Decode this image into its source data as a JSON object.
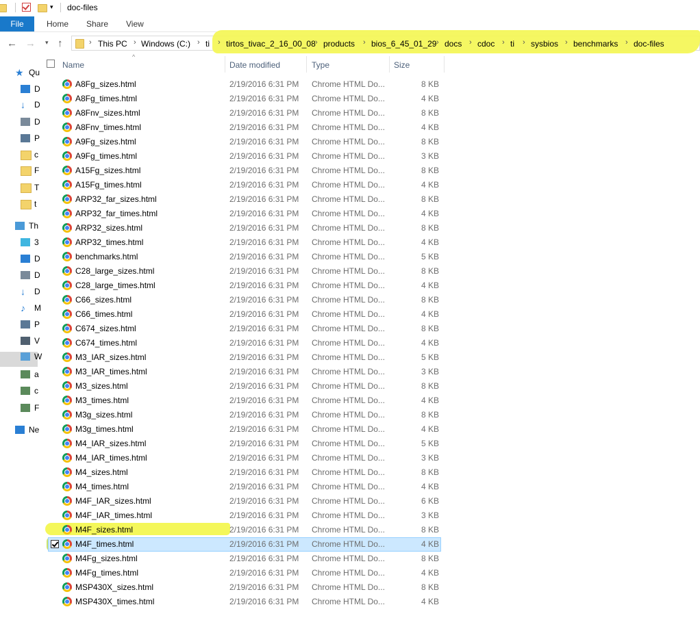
{
  "window": {
    "title": "doc-files"
  },
  "ribbon": {
    "file": "File",
    "tabs": [
      "Home",
      "Share",
      "View"
    ]
  },
  "address": {
    "crumbs": [
      "This PC",
      "Windows (C:)",
      "ti",
      "tirtos_tivac_2_16_00_08",
      "products",
      "bios_6_45_01_29",
      "docs",
      "cdoc",
      "ti",
      "sysbios",
      "benchmarks",
      "doc-files"
    ]
  },
  "columns": {
    "name": "Name",
    "date": "Date modified",
    "type": "Type",
    "size": "Size"
  },
  "sidebar": {
    "items": [
      {
        "label": "Qu",
        "icon": "star-icon"
      },
      {
        "label": "D",
        "icon": "desktop-icon"
      },
      {
        "label": "D",
        "icon": "download-icon"
      },
      {
        "label": "D",
        "icon": "document-icon"
      },
      {
        "label": "P",
        "icon": "picture-icon"
      },
      {
        "label": "c",
        "icon": "folder-icon"
      },
      {
        "label": "F",
        "icon": "folder-icon"
      },
      {
        "label": "T",
        "icon": "folder-icon"
      },
      {
        "label": "t",
        "icon": "folder-icon"
      },
      {
        "label": "Th",
        "icon": "computer-icon"
      },
      {
        "label": "3",
        "icon": "cube-icon"
      },
      {
        "label": "D",
        "icon": "desktop-icon"
      },
      {
        "label": "D",
        "icon": "document-icon"
      },
      {
        "label": "D",
        "icon": "download-icon"
      },
      {
        "label": "M",
        "icon": "music-icon"
      },
      {
        "label": "P",
        "icon": "picture-icon"
      },
      {
        "label": "V",
        "icon": "video-icon"
      },
      {
        "label": "W",
        "icon": "drive-icon"
      },
      {
        "label": "a",
        "icon": "network-drive-icon"
      },
      {
        "label": "c",
        "icon": "network-drive-icon"
      },
      {
        "label": "F",
        "icon": "network-drive-icon"
      },
      {
        "label": "Ne",
        "icon": "network-icon"
      }
    ]
  },
  "files": [
    {
      "name": "A8Fg_sizes.html",
      "date": "2/19/2016 6:31 PM",
      "type": "Chrome HTML Do...",
      "size": "8 KB"
    },
    {
      "name": "A8Fg_times.html",
      "date": "2/19/2016 6:31 PM",
      "type": "Chrome HTML Do...",
      "size": "4 KB"
    },
    {
      "name": "A8Fnv_sizes.html",
      "date": "2/19/2016 6:31 PM",
      "type": "Chrome HTML Do...",
      "size": "8 KB"
    },
    {
      "name": "A8Fnv_times.html",
      "date": "2/19/2016 6:31 PM",
      "type": "Chrome HTML Do...",
      "size": "4 KB"
    },
    {
      "name": "A9Fg_sizes.html",
      "date": "2/19/2016 6:31 PM",
      "type": "Chrome HTML Do...",
      "size": "8 KB"
    },
    {
      "name": "A9Fg_times.html",
      "date": "2/19/2016 6:31 PM",
      "type": "Chrome HTML Do...",
      "size": "3 KB"
    },
    {
      "name": "A15Fg_sizes.html",
      "date": "2/19/2016 6:31 PM",
      "type": "Chrome HTML Do...",
      "size": "8 KB"
    },
    {
      "name": "A15Fg_times.html",
      "date": "2/19/2016 6:31 PM",
      "type": "Chrome HTML Do...",
      "size": "4 KB"
    },
    {
      "name": "ARP32_far_sizes.html",
      "date": "2/19/2016 6:31 PM",
      "type": "Chrome HTML Do...",
      "size": "8 KB"
    },
    {
      "name": "ARP32_far_times.html",
      "date": "2/19/2016 6:31 PM",
      "type": "Chrome HTML Do...",
      "size": "4 KB"
    },
    {
      "name": "ARP32_sizes.html",
      "date": "2/19/2016 6:31 PM",
      "type": "Chrome HTML Do...",
      "size": "8 KB"
    },
    {
      "name": "ARP32_times.html",
      "date": "2/19/2016 6:31 PM",
      "type": "Chrome HTML Do...",
      "size": "4 KB"
    },
    {
      "name": "benchmarks.html",
      "date": "2/19/2016 6:31 PM",
      "type": "Chrome HTML Do...",
      "size": "5 KB"
    },
    {
      "name": "C28_large_sizes.html",
      "date": "2/19/2016 6:31 PM",
      "type": "Chrome HTML Do...",
      "size": "8 KB"
    },
    {
      "name": "C28_large_times.html",
      "date": "2/19/2016 6:31 PM",
      "type": "Chrome HTML Do...",
      "size": "4 KB"
    },
    {
      "name": "C66_sizes.html",
      "date": "2/19/2016 6:31 PM",
      "type": "Chrome HTML Do...",
      "size": "8 KB"
    },
    {
      "name": "C66_times.html",
      "date": "2/19/2016 6:31 PM",
      "type": "Chrome HTML Do...",
      "size": "4 KB"
    },
    {
      "name": "C674_sizes.html",
      "date": "2/19/2016 6:31 PM",
      "type": "Chrome HTML Do...",
      "size": "8 KB"
    },
    {
      "name": "C674_times.html",
      "date": "2/19/2016 6:31 PM",
      "type": "Chrome HTML Do...",
      "size": "4 KB"
    },
    {
      "name": "M3_IAR_sizes.html",
      "date": "2/19/2016 6:31 PM",
      "type": "Chrome HTML Do...",
      "size": "5 KB"
    },
    {
      "name": "M3_IAR_times.html",
      "date": "2/19/2016 6:31 PM",
      "type": "Chrome HTML Do...",
      "size": "3 KB"
    },
    {
      "name": "M3_sizes.html",
      "date": "2/19/2016 6:31 PM",
      "type": "Chrome HTML Do...",
      "size": "8 KB"
    },
    {
      "name": "M3_times.html",
      "date": "2/19/2016 6:31 PM",
      "type": "Chrome HTML Do...",
      "size": "4 KB"
    },
    {
      "name": "M3g_sizes.html",
      "date": "2/19/2016 6:31 PM",
      "type": "Chrome HTML Do...",
      "size": "8 KB"
    },
    {
      "name": "M3g_times.html",
      "date": "2/19/2016 6:31 PM",
      "type": "Chrome HTML Do...",
      "size": "4 KB"
    },
    {
      "name": "M4_IAR_sizes.html",
      "date": "2/19/2016 6:31 PM",
      "type": "Chrome HTML Do...",
      "size": "5 KB"
    },
    {
      "name": "M4_IAR_times.html",
      "date": "2/19/2016 6:31 PM",
      "type": "Chrome HTML Do...",
      "size": "3 KB"
    },
    {
      "name": "M4_sizes.html",
      "date": "2/19/2016 6:31 PM",
      "type": "Chrome HTML Do...",
      "size": "8 KB"
    },
    {
      "name": "M4_times.html",
      "date": "2/19/2016 6:31 PM",
      "type": "Chrome HTML Do...",
      "size": "4 KB"
    },
    {
      "name": "M4F_IAR_sizes.html",
      "date": "2/19/2016 6:31 PM",
      "type": "Chrome HTML Do...",
      "size": "6 KB"
    },
    {
      "name": "M4F_IAR_times.html",
      "date": "2/19/2016 6:31 PM",
      "type": "Chrome HTML Do...",
      "size": "3 KB"
    },
    {
      "name": "M4F_sizes.html",
      "date": "2/19/2016 6:31 PM",
      "type": "Chrome HTML Do...",
      "size": "8 KB"
    },
    {
      "name": "M4F_times.html",
      "date": "2/19/2016 6:31 PM",
      "type": "Chrome HTML Do...",
      "size": "4 KB",
      "selected": true
    },
    {
      "name": "M4Fg_sizes.html",
      "date": "2/19/2016 6:31 PM",
      "type": "Chrome HTML Do...",
      "size": "8 KB"
    },
    {
      "name": "M4Fg_times.html",
      "date": "2/19/2016 6:31 PM",
      "type": "Chrome HTML Do...",
      "size": "4 KB"
    },
    {
      "name": "MSP430X_sizes.html",
      "date": "2/19/2016 6:31 PM",
      "type": "Chrome HTML Do...",
      "size": "8 KB"
    },
    {
      "name": "MSP430X_times.html",
      "date": "2/19/2016 6:31 PM",
      "type": "Chrome HTML Do...",
      "size": "4 KB"
    }
  ],
  "colors": {
    "accent": "#1979ca",
    "selection": "#cce8ff",
    "highlighter": "#f4f75a"
  }
}
